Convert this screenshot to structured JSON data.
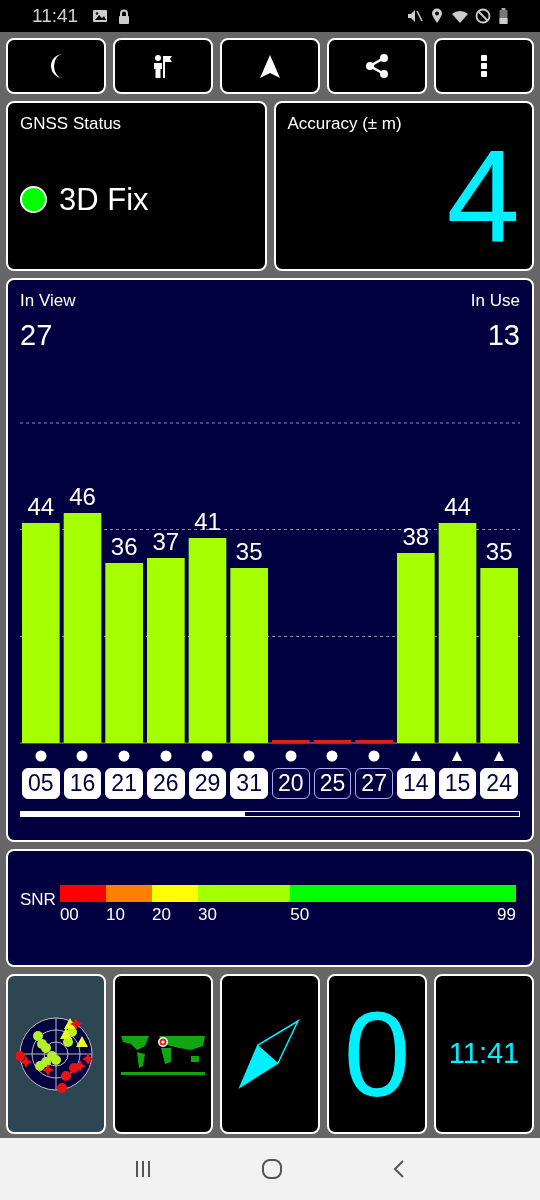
{
  "status_bar": {
    "time": "11:41"
  },
  "gnss_status": {
    "title": "GNSS Status",
    "value": "3D Fix",
    "color": "#00ff00"
  },
  "accuracy": {
    "title": "Accuracy (± m)",
    "value": "4"
  },
  "signal_panel": {
    "in_view_label": "In View",
    "in_view": "27",
    "in_use_label": "In Use",
    "in_use": "13",
    "chart_data": {
      "type": "bar",
      "categories": [
        "05",
        "16",
        "21",
        "26",
        "29",
        "31",
        "20",
        "25",
        "27",
        "14",
        "15",
        "24"
      ],
      "values": [
        44,
        46,
        36,
        37,
        41,
        35,
        0,
        0,
        0,
        38,
        44,
        35
      ],
      "value_labels": [
        "44",
        "46",
        "36",
        "37",
        "41",
        "35",
        null,
        null,
        null,
        "38",
        "44",
        "35"
      ]
    },
    "satellites": [
      {
        "kind": "circle",
        "used": true
      },
      {
        "kind": "circle",
        "used": true
      },
      {
        "kind": "circle",
        "used": true
      },
      {
        "kind": "circle",
        "used": true
      },
      {
        "kind": "circle",
        "used": true
      },
      {
        "kind": "circle",
        "used": true
      },
      {
        "kind": "circle",
        "used": false
      },
      {
        "kind": "circle",
        "used": false
      },
      {
        "kind": "circle",
        "used": false
      },
      {
        "kind": "triangle",
        "used": true
      },
      {
        "kind": "triangle",
        "used": true
      },
      {
        "kind": "triangle",
        "used": true
      }
    ]
  },
  "snr_legend": {
    "label": "SNR",
    "segments": [
      {
        "tick": "00",
        "color": "#ff0000"
      },
      {
        "tick": "10",
        "color": "#ff8000"
      },
      {
        "tick": "20",
        "color": "#ffff00"
      },
      {
        "tick": "30",
        "color": "#a6ff00"
      },
      {
        "tick": "50",
        "color": "#00ff00"
      }
    ],
    "end_tick": "99"
  },
  "tiles": {
    "speed": "0",
    "clock": "11:41"
  }
}
